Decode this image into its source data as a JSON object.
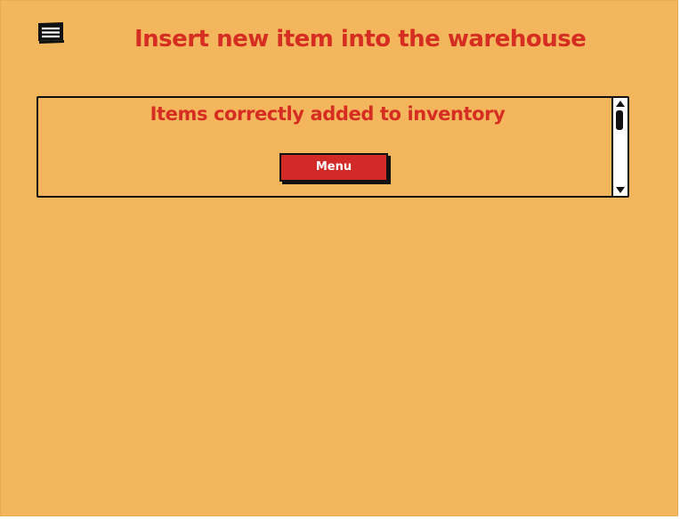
{
  "header": {
    "title": "Insert new item into the warehouse",
    "menu_icon": "hamburger-menu-icon"
  },
  "panel": {
    "message": "Items correctly added to inventory",
    "menu_button_label": "Menu"
  },
  "colors": {
    "background": "#f4b65c",
    "accent_red": "#d62d22",
    "button_red": "#d22a26",
    "outline": "#111111"
  }
}
